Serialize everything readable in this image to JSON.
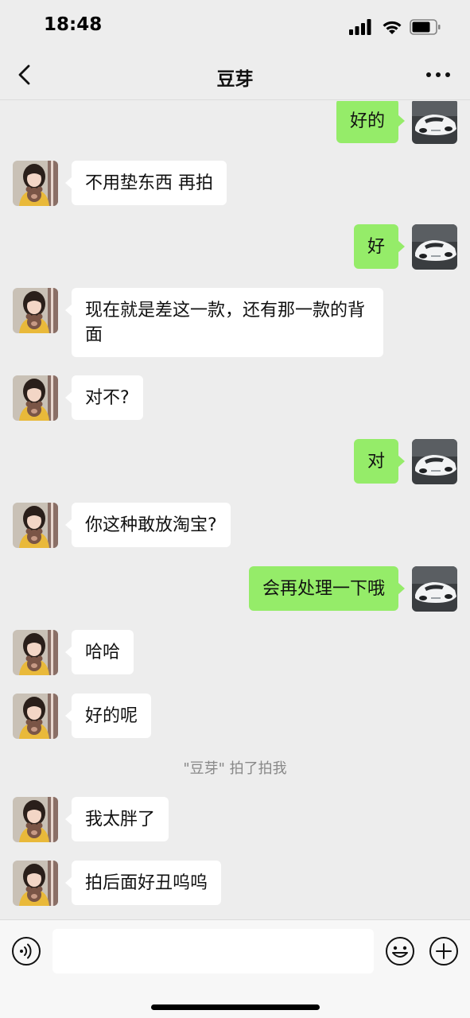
{
  "status_bar": {
    "time": "18:48"
  },
  "nav": {
    "title": "豆芽"
  },
  "messages": [
    {
      "side": "out",
      "text": "好的"
    },
    {
      "side": "in",
      "text": "不用垫东西 再拍"
    },
    {
      "side": "out",
      "text": "好"
    },
    {
      "side": "in",
      "text": "现在就是差这一款，还有那一款的背面"
    },
    {
      "side": "in",
      "text": "对不?"
    },
    {
      "side": "out",
      "text": "对"
    },
    {
      "side": "in",
      "text": "你这种敢放淘宝?"
    },
    {
      "side": "out",
      "text": "会再处理一下哦"
    },
    {
      "side": "in",
      "text": "哈哈"
    },
    {
      "side": "in",
      "text": "好的呢"
    },
    {
      "side": "system",
      "text": "\"豆芽\" 拍了拍我"
    },
    {
      "side": "in",
      "text": "我太胖了"
    },
    {
      "side": "in",
      "text": "拍后面好丑呜呜"
    }
  ],
  "input": {
    "value": "",
    "placeholder": ""
  },
  "icons": {
    "back": "chevron-left-icon",
    "more": "more-dots-icon",
    "voice": "voice-icon",
    "emoji": "emoji-icon",
    "plus": "plus-icon"
  },
  "colors": {
    "background": "#ededed",
    "incoming_bubble": "#ffffff",
    "outgoing_bubble": "#95ec69",
    "system_text": "#888888"
  }
}
